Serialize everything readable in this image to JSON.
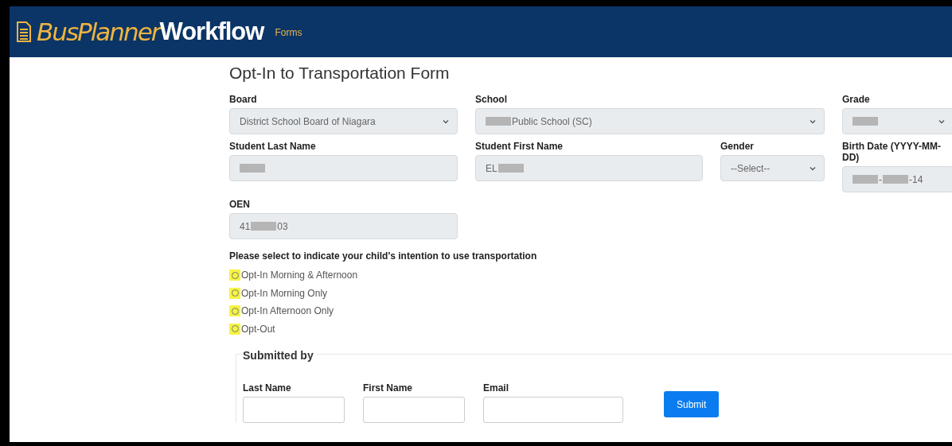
{
  "header": {
    "brand_primary": "BusPlanner",
    "brand_secondary": "Workflow",
    "nav": [
      {
        "label": "Forms"
      }
    ]
  },
  "form": {
    "title": "Opt-In to Transportation Form",
    "fields": [
      {
        "label": "Board",
        "kind": "select",
        "value": [
          {
            "kind": "text",
            "text": "District School Board of Niagara"
          }
        ]
      },
      {
        "label": "School",
        "kind": "select",
        "value": [
          {
            "kind": "redacted"
          },
          {
            "kind": "text",
            "text": "Public School (SC)"
          }
        ]
      },
      {
        "label": "Grade",
        "kind": "select",
        "value": [
          {
            "kind": "redacted"
          }
        ]
      },
      {
        "label": "Student Last Name",
        "kind": "input",
        "value": [
          {
            "kind": "redacted"
          }
        ]
      },
      {
        "label": "Student First Name",
        "kind": "input",
        "value": [
          {
            "kind": "text",
            "text": "EL"
          },
          {
            "kind": "redacted"
          }
        ]
      },
      {
        "label": "Gender",
        "kind": "select",
        "value": [
          {
            "kind": "text",
            "text": "--Select--"
          }
        ]
      },
      {
        "label": "Birth Date (YYYY-MM-DD)",
        "kind": "input",
        "value": [
          {
            "kind": "redacted"
          },
          {
            "kind": "text",
            "text": "-"
          },
          {
            "kind": "redacted"
          },
          {
            "kind": "text",
            "text": "-14"
          }
        ]
      },
      {
        "label": "OEN",
        "kind": "input",
        "value": [
          {
            "kind": "text",
            "text": "41"
          },
          {
            "kind": "redacted"
          },
          {
            "kind": "text",
            "text": "03"
          }
        ]
      }
    ],
    "question": "Please select to indicate your child's intention to use transportation",
    "options": [
      {
        "label": "Opt-In Morning & Afternoon",
        "selected": false,
        "highlighted": true
      },
      {
        "label": "Opt-In Morning Only",
        "selected": false,
        "highlighted": true
      },
      {
        "label": "Opt-In Afternoon Only",
        "selected": false,
        "highlighted": true
      },
      {
        "label": "Opt-Out",
        "selected": false,
        "highlighted": true
      }
    ],
    "submitted_by": {
      "legend": "Submitted by",
      "fields": [
        {
          "label": "Last Name"
        },
        {
          "label": "First Name"
        },
        {
          "label": "Email"
        }
      ],
      "button": "Submit"
    }
  }
}
